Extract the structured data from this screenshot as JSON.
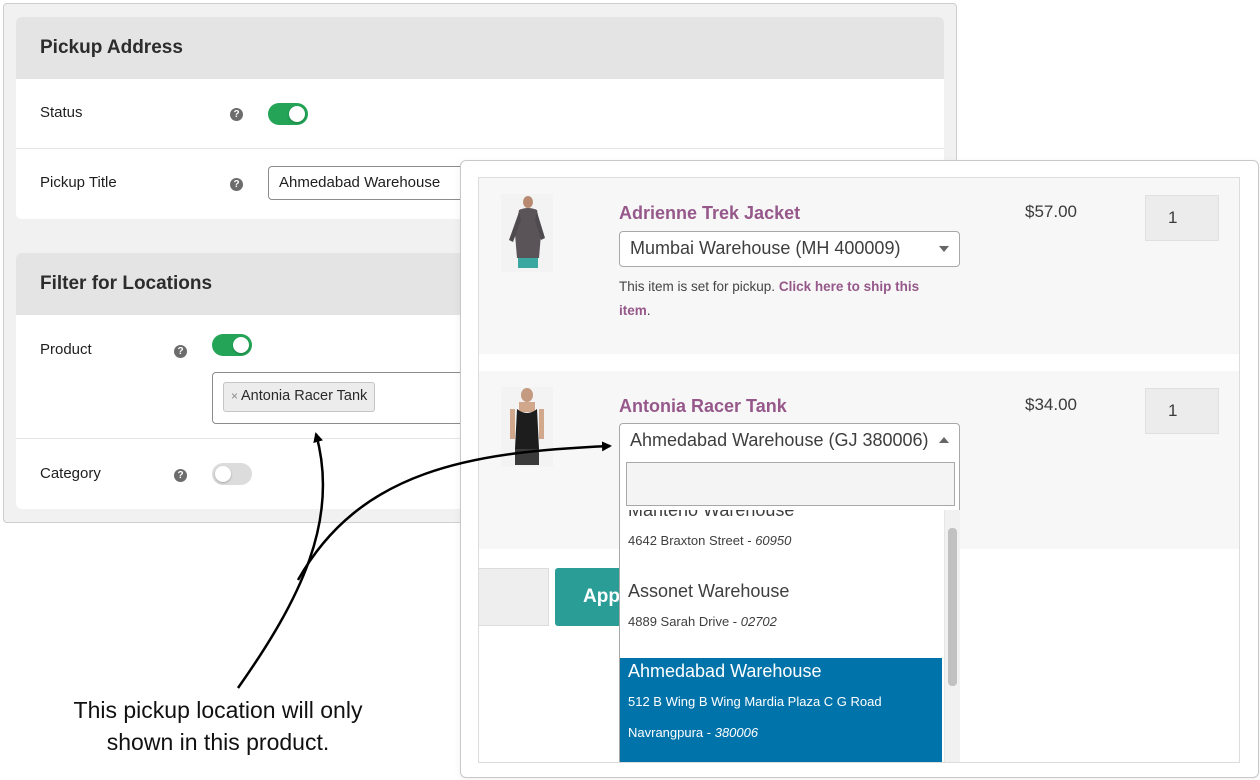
{
  "settings": {
    "pickup_address": {
      "heading": "Pickup Address",
      "status_label": "Status",
      "status_enabled": true,
      "pickup_title_label": "Pickup Title",
      "pickup_title_value": "Ahmedabad Warehouse"
    },
    "filter_locations": {
      "heading": "Filter for Locations",
      "product_label": "Product",
      "product_enabled": true,
      "product_chip_remove": "×",
      "product_chip": "Antonia Racer Tank",
      "category_label": "Category",
      "category_enabled": false
    },
    "help_icon": "?"
  },
  "cart": {
    "items": [
      {
        "name": "Adrienne Trek Jacket",
        "price": "$57.00",
        "qty": "1",
        "location": "Mumbai Warehouse (MH 400009)",
        "note_prefix": "This item is set for pickup.",
        "note_link": "Click here to ship this item",
        "note_suffix": "."
      },
      {
        "name": "Antonia Racer Tank",
        "price": "$34.00",
        "qty": "1",
        "location": "Ahmedabad Warehouse (GJ 380006)"
      }
    ],
    "dropdown": {
      "search_value": "",
      "options": [
        {
          "name": "Manteno Warehouse",
          "address": "4642 Braxton Street - ",
          "zip": "60950"
        },
        {
          "name": "Assonet Warehouse",
          "address": "4889 Sarah Drive - ",
          "zip": "02702"
        },
        {
          "name": "Ahmedabad Warehouse",
          "address_line1": "512 B Wing B Wing Mardia Plaza C G Road",
          "address_line2": "Navrangpura - ",
          "zip": "380006"
        }
      ]
    },
    "apply_button": "Apply"
  },
  "annotation": {
    "line1": "This pickup location will only",
    "line2": "shown in this product."
  },
  "colors": {
    "toggle_on": "#23a457",
    "product_link": "#96588a",
    "selected_option": "#0073aa",
    "apply_button": "#2a9d96"
  }
}
